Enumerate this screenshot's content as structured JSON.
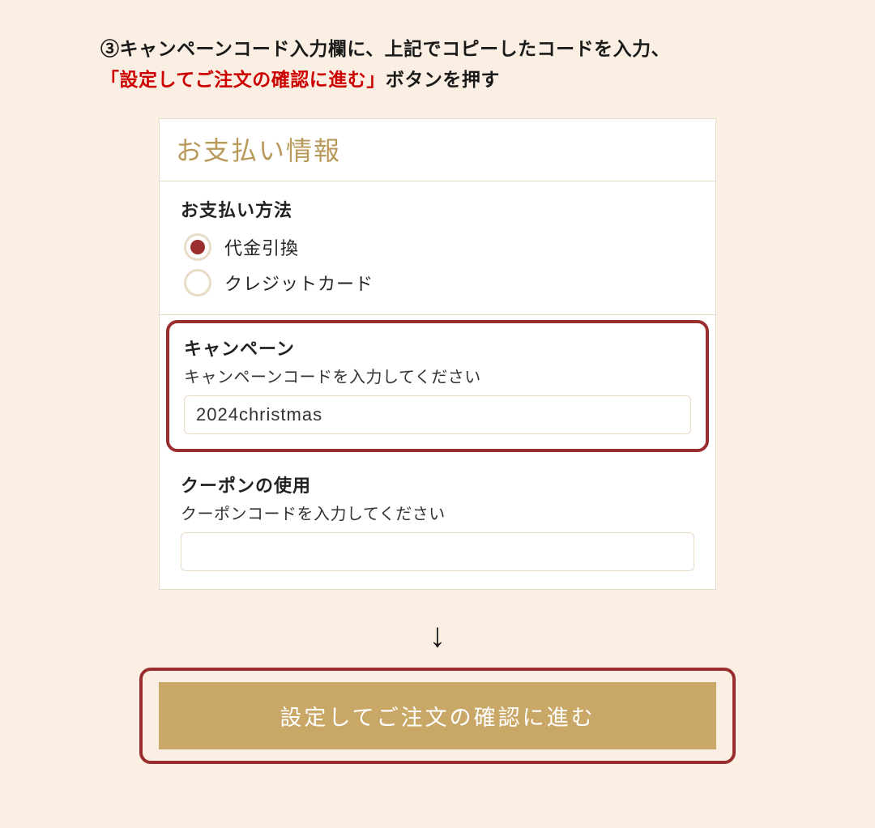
{
  "instruction": {
    "prefix": "③キャンペーンコード入力欄に、上記でコピーしたコードを入力、",
    "highlight": "「設定してご注文の確認に進む」",
    "suffix": "ボタンを押す"
  },
  "panel": {
    "title": "お支払い情報"
  },
  "payment_method": {
    "heading": "お支払い方法",
    "options": [
      {
        "label": "代金引換",
        "selected": true
      },
      {
        "label": "クレジットカード",
        "selected": false
      }
    ]
  },
  "campaign": {
    "title": "キャンペーン",
    "help": "キャンペーンコードを入力してください",
    "value": "2024christmas"
  },
  "coupon": {
    "title": "クーポンの使用",
    "help": "クーポンコードを入力してください",
    "value": ""
  },
  "arrow_glyph": "↓",
  "confirm_button": "設定してご注文の確認に進む"
}
